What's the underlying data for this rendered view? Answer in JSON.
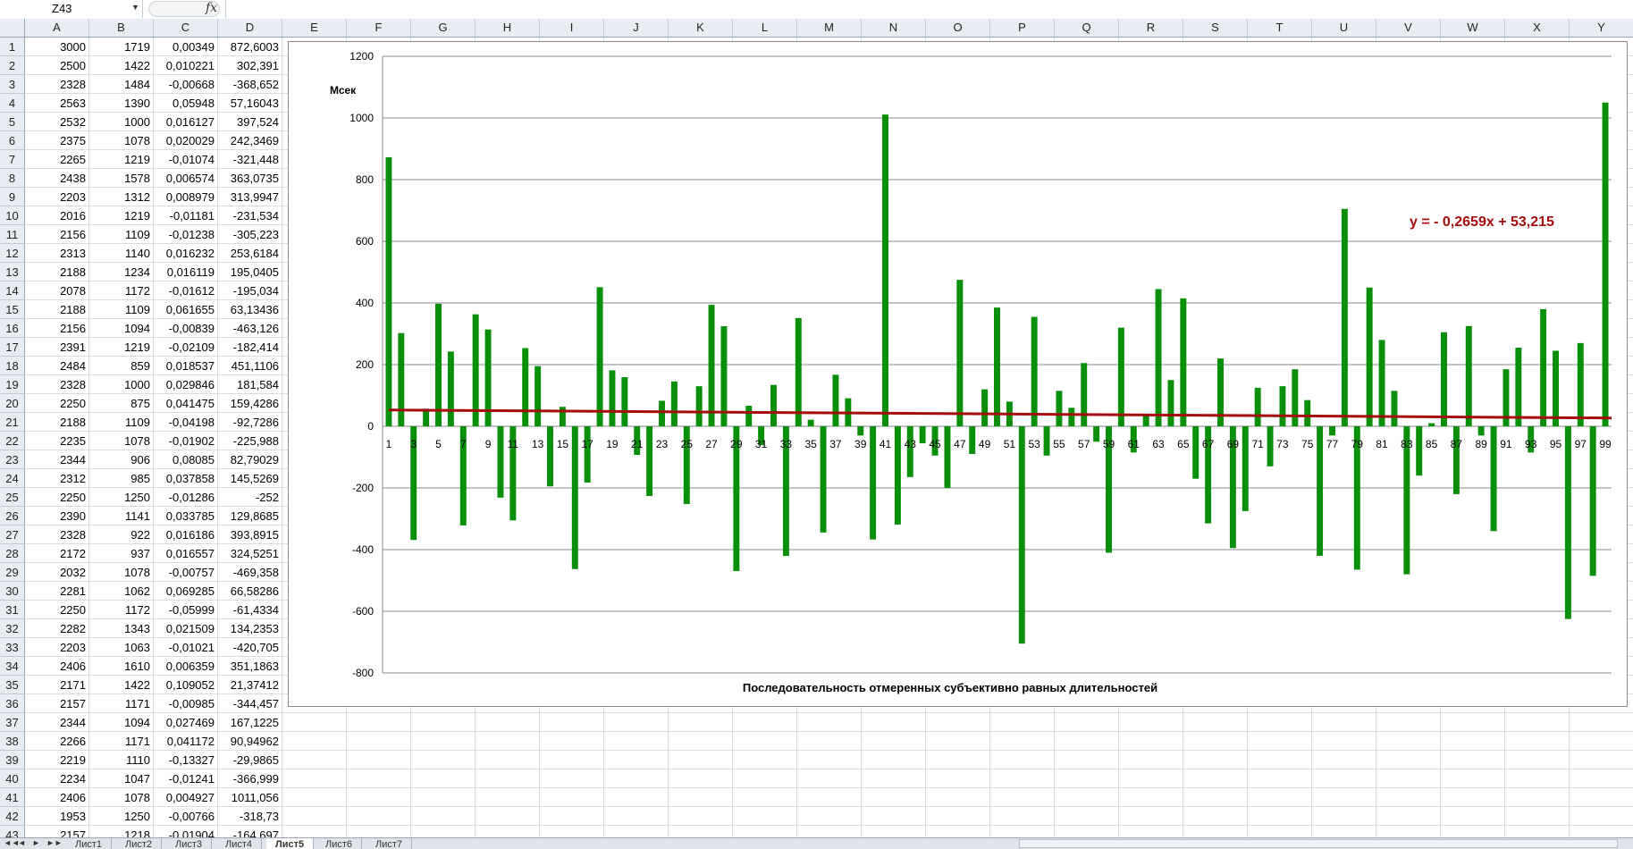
{
  "formula_bar": {
    "name_box": "Z43",
    "fx_label": "fx"
  },
  "columns": [
    "A",
    "B",
    "C",
    "D",
    "E",
    "F",
    "G",
    "H",
    "I",
    "J",
    "K",
    "L",
    "M",
    "N",
    "O",
    "P",
    "Q",
    "R",
    "S",
    "T",
    "U",
    "V",
    "W",
    "X",
    "Y"
  ],
  "rows": [
    {
      "n": "1",
      "a": "3000",
      "b": "1719",
      "c": "0,00349",
      "d": "872,6003"
    },
    {
      "n": "2",
      "a": "2500",
      "b": "1422",
      "c": "0,010221",
      "d": "302,391"
    },
    {
      "n": "3",
      "a": "2328",
      "b": "1484",
      "c": "-0,00668",
      "d": "-368,652"
    },
    {
      "n": "4",
      "a": "2563",
      "b": "1390",
      "c": "0,05948",
      "d": "57,16043"
    },
    {
      "n": "5",
      "a": "2532",
      "b": "1000",
      "c": "0,016127",
      "d": "397,524"
    },
    {
      "n": "6",
      "a": "2375",
      "b": "1078",
      "c": "0,020029",
      "d": "242,3469"
    },
    {
      "n": "7",
      "a": "2265",
      "b": "1219",
      "c": "-0,01074",
      "d": "-321,448"
    },
    {
      "n": "8",
      "a": "2438",
      "b": "1578",
      "c": "0,006574",
      "d": "363,0735"
    },
    {
      "n": "9",
      "a": "2203",
      "b": "1312",
      "c": "0,008979",
      "d": "313,9947"
    },
    {
      "n": "10",
      "a": "2016",
      "b": "1219",
      "c": "-0,01181",
      "d": "-231,534"
    },
    {
      "n": "11",
      "a": "2156",
      "b": "1109",
      "c": "-0,01238",
      "d": "-305,223"
    },
    {
      "n": "12",
      "a": "2313",
      "b": "1140",
      "c": "0,016232",
      "d": "253,6184"
    },
    {
      "n": "13",
      "a": "2188",
      "b": "1234",
      "c": "0,016119",
      "d": "195,0405"
    },
    {
      "n": "14",
      "a": "2078",
      "b": "1172",
      "c": "-0,01612",
      "d": "-195,034"
    },
    {
      "n": "15",
      "a": "2188",
      "b": "1109",
      "c": "0,061655",
      "d": "63,13436"
    },
    {
      "n": "16",
      "a": "2156",
      "b": "1094",
      "c": "-0,00839",
      "d": "-463,126"
    },
    {
      "n": "17",
      "a": "2391",
      "b": "1219",
      "c": "-0,02109",
      "d": "-182,414"
    },
    {
      "n": "18",
      "a": "2484",
      "b": "859",
      "c": "0,018537",
      "d": "451,1106"
    },
    {
      "n": "19",
      "a": "2328",
      "b": "1000",
      "c": "0,029846",
      "d": "181,584"
    },
    {
      "n": "20",
      "a": "2250",
      "b": "875",
      "c": "0,041475",
      "d": "159,4286"
    },
    {
      "n": "21",
      "a": "2188",
      "b": "1109",
      "c": "-0,04198",
      "d": "-92,7286"
    },
    {
      "n": "22",
      "a": "2235",
      "b": "1078",
      "c": "-0,01902",
      "d": "-225,988"
    },
    {
      "n": "23",
      "a": "2344",
      "b": "906",
      "c": "0,08085",
      "d": "82,79029"
    },
    {
      "n": "24",
      "a": "2312",
      "b": "985",
      "c": "0,037858",
      "d": "145,5269"
    },
    {
      "n": "25",
      "a": "2250",
      "b": "1250",
      "c": "-0,01286",
      "d": "-252"
    },
    {
      "n": "26",
      "a": "2390",
      "b": "1141",
      "c": "0,033785",
      "d": "129,8685"
    },
    {
      "n": "27",
      "a": "2328",
      "b": "922",
      "c": "0,016186",
      "d": "393,8915"
    },
    {
      "n": "28",
      "a": "2172",
      "b": "937",
      "c": "0,016557",
      "d": "324,5251"
    },
    {
      "n": "29",
      "a": "2032",
      "b": "1078",
      "c": "-0,00757",
      "d": "-469,358"
    },
    {
      "n": "30",
      "a": "2281",
      "b": "1062",
      "c": "0,069285",
      "d": "66,58286"
    },
    {
      "n": "31",
      "a": "2250",
      "b": "1172",
      "c": "-0,05999",
      "d": "-61,4334"
    },
    {
      "n": "32",
      "a": "2282",
      "b": "1343",
      "c": "0,021509",
      "d": "134,2353"
    },
    {
      "n": "33",
      "a": "2203",
      "b": "1063",
      "c": "-0,01021",
      "d": "-420,705"
    },
    {
      "n": "34",
      "a": "2406",
      "b": "1610",
      "c": "0,006359",
      "d": "351,1863"
    },
    {
      "n": "35",
      "a": "2171",
      "b": "1422",
      "c": "0,109052",
      "d": "21,37412"
    },
    {
      "n": "36",
      "a": "2157",
      "b": "1171",
      "c": "-0,00985",
      "d": "-344,457"
    },
    {
      "n": "37",
      "a": "2344",
      "b": "1094",
      "c": "0,027469",
      "d": "167,1225"
    },
    {
      "n": "38",
      "a": "2266",
      "b": "1171",
      "c": "0,041172",
      "d": "90,94962"
    },
    {
      "n": "39",
      "a": "2219",
      "b": "1110",
      "c": "-0,13327",
      "d": "-29,9865"
    },
    {
      "n": "40",
      "a": "2234",
      "b": "1047",
      "c": "-0,01241",
      "d": "-366,999"
    },
    {
      "n": "41",
      "a": "2406",
      "b": "1078",
      "c": "0,004927",
      "d": "1011,056"
    },
    {
      "n": "42",
      "a": "1953",
      "b": "1250",
      "c": "-0,00766",
      "d": "-318,73"
    },
    {
      "n": "43",
      "a": "2157",
      "b": "1218",
      "c": "-0,01904",
      "d": "-164,697"
    }
  ],
  "chart_data": {
    "type": "bar",
    "ylabel": "Мсек",
    "xlabel": "Последовательность отмеренных субъективно равных длительностей",
    "ylim": [
      -800,
      1200
    ],
    "yticks": [
      1200,
      1000,
      800,
      600,
      400,
      200,
      0,
      -200,
      -400,
      -600,
      -800
    ],
    "x_tick_labels": [
      "1",
      "3",
      "5",
      "7",
      "9",
      "11",
      "13",
      "15",
      "17",
      "19",
      "21",
      "23",
      "25",
      "27",
      "29",
      "31",
      "33",
      "35",
      "37",
      "39",
      "41",
      "43",
      "45",
      "47",
      "49",
      "51",
      "53",
      "55",
      "57",
      "59",
      "61",
      "63",
      "65",
      "67",
      "69",
      "71",
      "73",
      "75",
      "77",
      "79",
      "81",
      "83",
      "85",
      "87",
      "89",
      "91",
      "93",
      "95",
      "97",
      "99"
    ],
    "values": [
      872.6,
      302.4,
      -368.7,
      57.2,
      397.5,
      242.3,
      -321.4,
      363.1,
      314.0,
      -231.5,
      -305.2,
      253.6,
      195.0,
      -195.0,
      63.1,
      -463.1,
      -182.4,
      451.1,
      181.6,
      159.4,
      -92.7,
      -226.0,
      82.8,
      145.5,
      -252.0,
      129.9,
      393.9,
      324.5,
      -469.4,
      66.6,
      -61.4,
      134.2,
      -420.7,
      351.2,
      21.4,
      -344.5,
      167.1,
      90.9,
      -30.0,
      -367.0,
      1011.1,
      -318.7,
      -164.7,
      -55,
      -95,
      -200,
      475,
      -90,
      120,
      385,
      80,
      -705,
      355,
      -95,
      115,
      60,
      205,
      -50,
      -410,
      320,
      -85,
      35,
      445,
      150,
      415,
      -170,
      -315,
      220,
      -395,
      -275,
      125,
      -130,
      130,
      185,
      85,
      -420,
      -30,
      705,
      -465,
      450,
      280,
      115,
      -480,
      -160,
      10,
      305,
      -220,
      325,
      -30,
      -340,
      185,
      255,
      -85,
      380,
      245,
      -625,
      270,
      -485,
      1050
    ],
    "bar_color": "#0a8f0a",
    "trendline": {
      "label": "y = - 0,2659x + 53,215",
      "slope": -0.2659,
      "intercept": 53.215,
      "color": "#a50d0d"
    }
  },
  "sheet_tabs": {
    "nav": [
      "◄◄",
      "◄",
      "►",
      "►►"
    ],
    "tabs": [
      "Лист1",
      "Лист2",
      "Лист3",
      "Лист4",
      "Лист5",
      "Лист6",
      "Лист7"
    ],
    "active": "Лист5"
  }
}
